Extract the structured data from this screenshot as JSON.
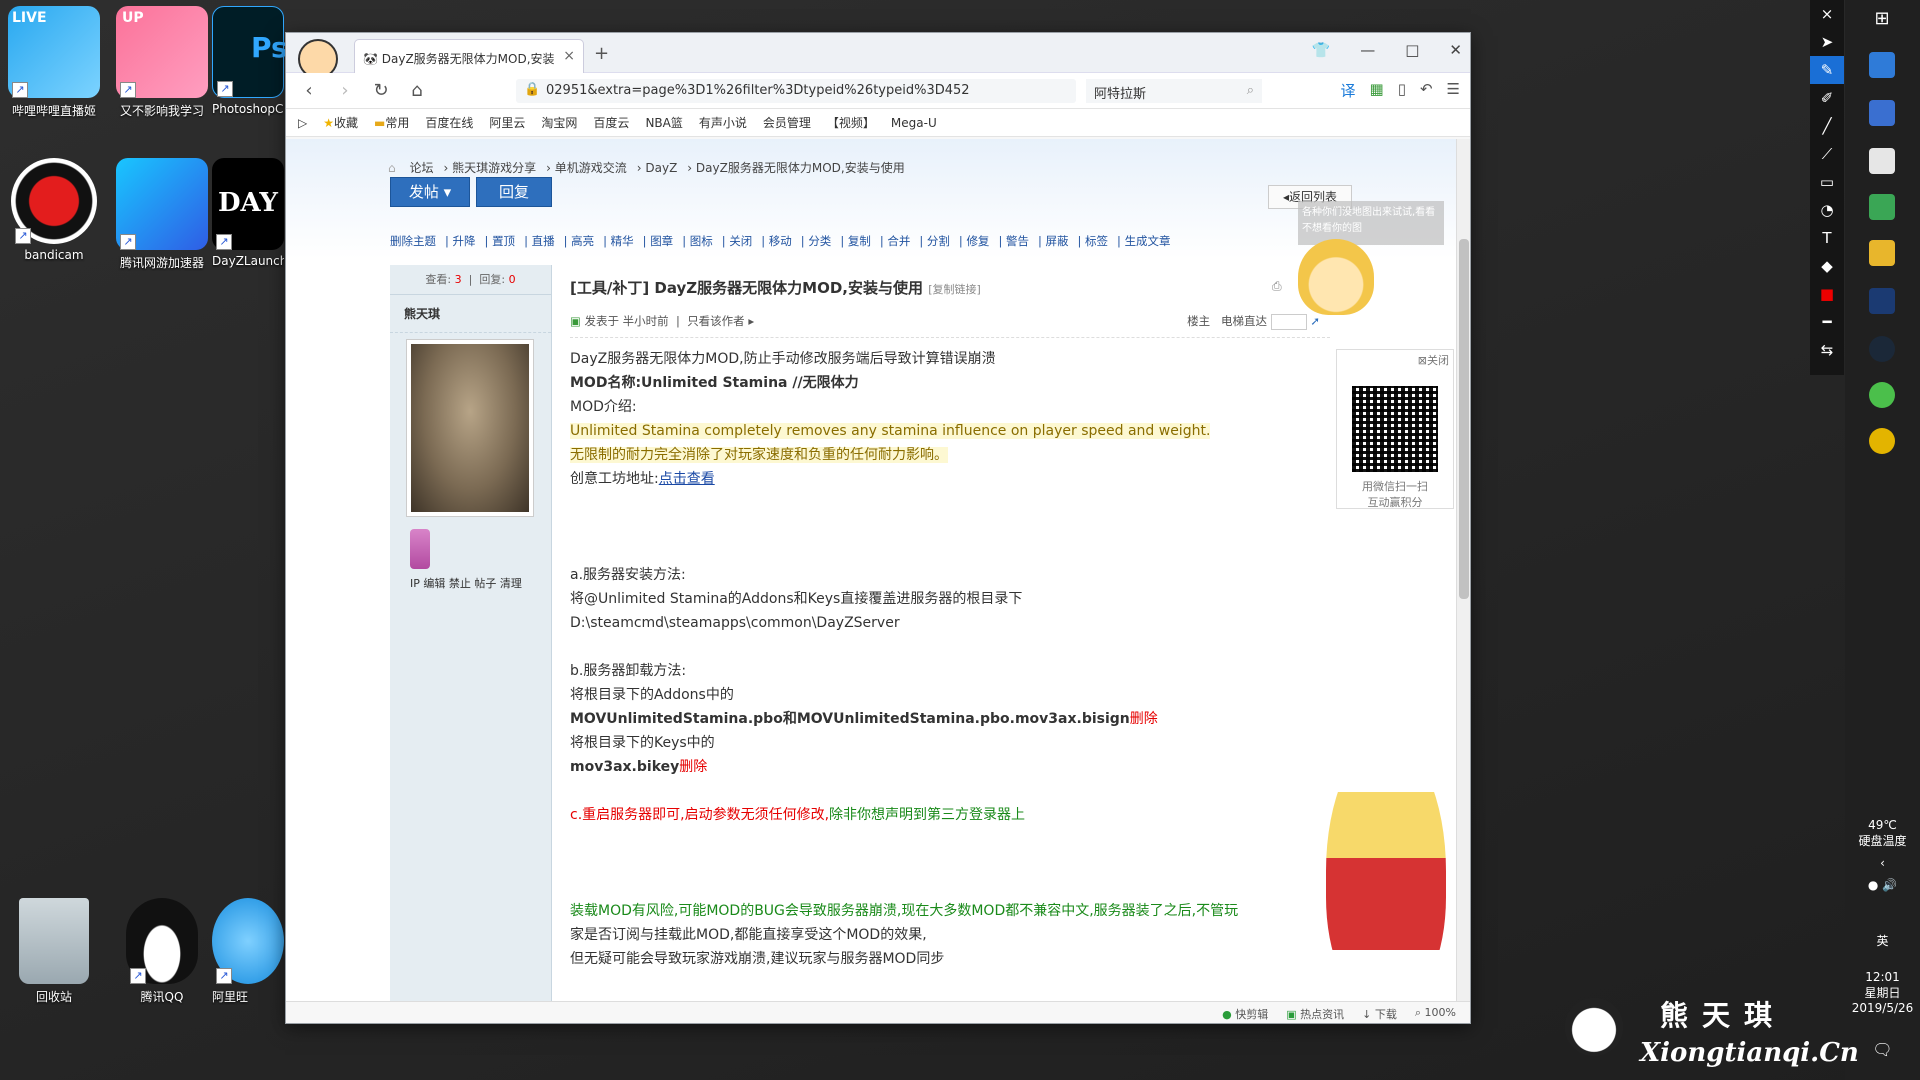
{
  "desktop": {
    "icons": [
      {
        "label": "哔哩哔哩直播姬",
        "badge": "LIVE"
      },
      {
        "label": "又不影响我学习",
        "badge": "UP"
      },
      {
        "label": "PhotoshopC",
        "badge": "Ps"
      },
      {
        "label": "bandicam"
      },
      {
        "label": "腾讯网游加速器"
      },
      {
        "label": "DayZLaunch"
      },
      {
        "label": "回收站"
      },
      {
        "label": "腾讯QQ"
      },
      {
        "label": "阿里旺"
      }
    ]
  },
  "browser": {
    "tab_title": "DayZ服务器无限体力MOD,安装",
    "url": "02951&extra=page%3D1%26filter%3Dtypeid%26typeid%3D452",
    "search_text": "阿特拉斯",
    "bookmarks": [
      "收藏",
      "常用",
      "百度在线",
      "阿里云",
      "淘宝网",
      "百度云",
      "NBA篮",
      "有声小说",
      "会员管理",
      "【视频】",
      "Mega-U"
    ],
    "status_items": [
      "快剪辑",
      "热点资讯",
      "下载",
      "100%"
    ]
  },
  "forum": {
    "breadcrumbs": [
      "论坛",
      "熊天琪游戏分享",
      "单机游戏交流",
      "DayZ",
      "DayZ服务器无限体力MOD,安装与使用"
    ],
    "new_post": "发帖",
    "reply": "回复",
    "back_to_list": "返回列表",
    "mod_actions": [
      "删除主题",
      "升降",
      "置顶",
      "直播",
      "高亮",
      "精华",
      "图章",
      "图标",
      "关闭",
      "移动",
      "分类",
      "复制",
      "合并",
      "分割",
      "修复",
      "警告",
      "屏蔽",
      "标签",
      "生成文章"
    ],
    "stats_views_label": "查看:",
    "stats_views": "3",
    "stats_replies_label": "回复:",
    "stats_replies": "0",
    "author": "熊天琪",
    "user_actions": "IP 编辑 禁止 帖子 清理",
    "title": "[工具/补丁] DayZ服务器无限体力MOD,安装与使用",
    "copy_link": "[复制链接]",
    "posted": "发表于 半小时前",
    "author_only": "只看该作者",
    "floor": "楼主",
    "jump": "电梯直达",
    "tooltip": "各种你们没地图出来试试,看看不想看你的图",
    "qr_close": "关闭",
    "qr_caption1": "用微信扫一扫",
    "qr_caption2": "互动赢积分"
  },
  "post": {
    "l1": "DayZ服务器无限体力MOD,防止手动修改服务端后导致计算错误崩溃",
    "l2": "MOD名称:Unlimited Stamina //无限体力",
    "l3": "MOD介绍:",
    "l4": "Unlimited Stamina completely removes any stamina influence on player speed and weight.",
    "l5": "无限制的耐力完全消除了对玩家速度和负重的任何耐力影响。",
    "l6_prefix": "创意工坊地址:",
    "l6_link": "点击查看",
    "a_title": "a.服务器安装方法:",
    "a_1": "将@Unlimited Stamina的Addons和Keys直接覆盖进服务器的根目录下",
    "a_2": "D:\\steamcmd\\steamapps\\common\\DayZServer",
    "b_title": "b.服务器卸载方法:",
    "b_1": "将根目录下的Addons中的",
    "b_2": "MOVUnlimitedStamina.pbo和MOVUnlimitedStamina.pbo.mov3ax.bisign",
    "b_del": "删除",
    "b_3": "将根目录下的Keys中的",
    "b_4": "mov3ax.bikey",
    "c_red": "c.重启服务器即可,启动参数无须任何修改,",
    "c_green": "除非你想声明到第三方登录器上",
    "w1": "装载MOD有风险,可能MOD的BUG会导致服务器崩溃,现在大多数MOD都不兼容中文,服务器装了之后,不管玩",
    "w2": "家是否订阅与挂载此MOD,都能直接享受这个MOD的效果,",
    "w3": "但无疑可能会导致玩家游戏崩溃,建议玩家与服务器MOD同步"
  },
  "system": {
    "temp": "49℃",
    "temp_label": "硬盘温度",
    "ime": "英",
    "time": "12:01",
    "weekday": "星期日",
    "date": "2019/5/26"
  },
  "watermark": {
    "cn": "熊天琪",
    "en": "Xiongtianqi.Cn"
  }
}
